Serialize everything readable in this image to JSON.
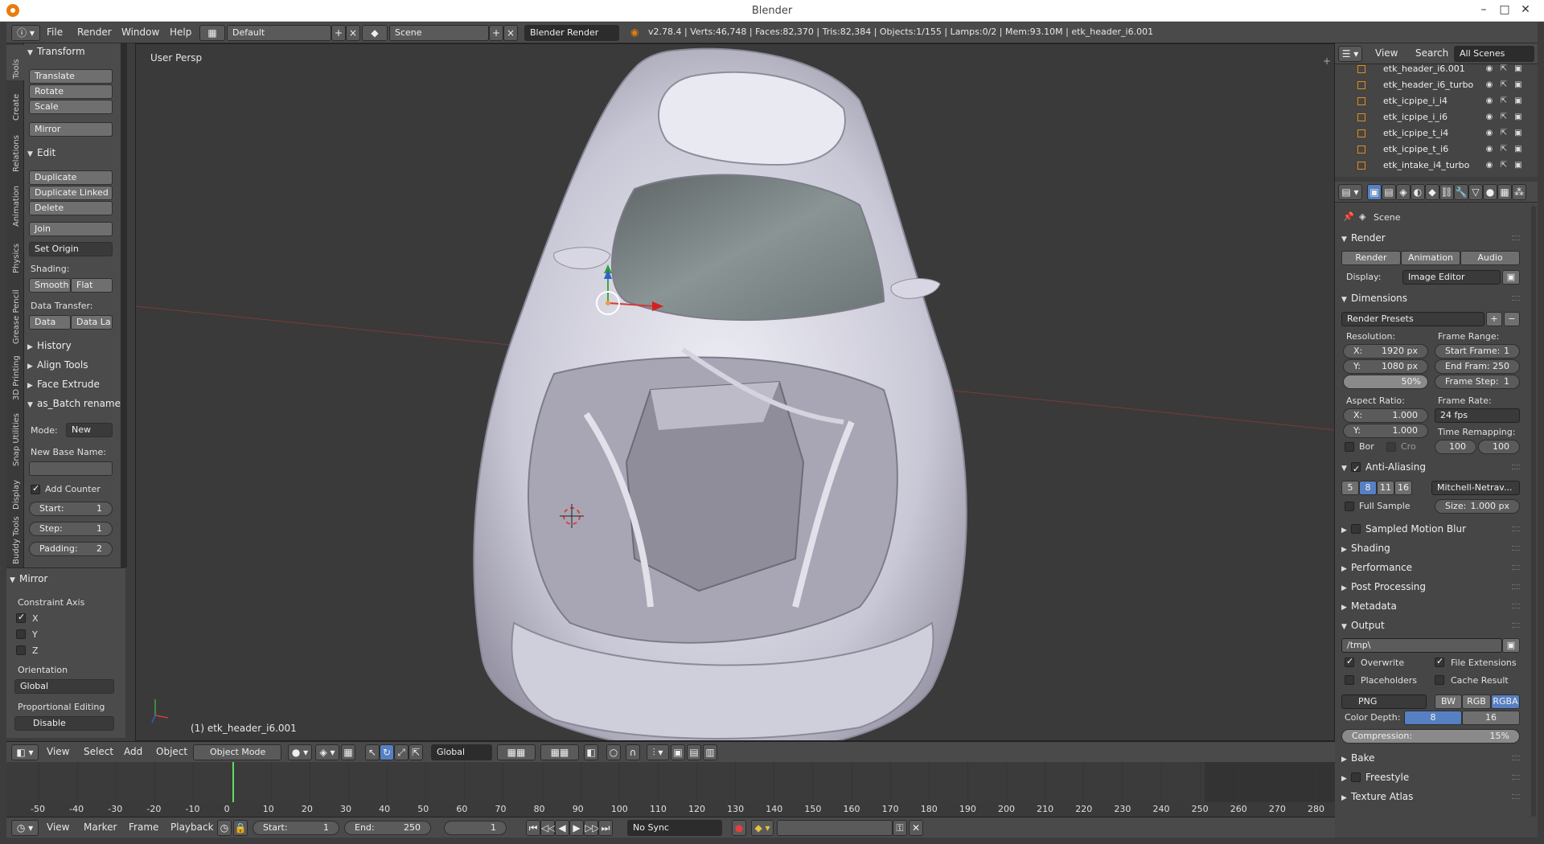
{
  "os": {
    "title": "Blender"
  },
  "menu": {
    "items": [
      "File",
      "Render",
      "Window",
      "Help"
    ],
    "screen_layout": "Default",
    "scene": "Scene",
    "engine": "Blender Render",
    "stats": "v2.78.4 | Verts:46,748 | Faces:82,370 | Tris:82,384 | Objects:1/155 | Lamps:0/2 | Mem:93.10M | etk_header_i6.001"
  },
  "tabs": [
    "Tools",
    "Create",
    "Relations",
    "Animation",
    "Physics",
    "Grease Pencil",
    "3D Printing",
    "Snap Utilities",
    "Display",
    "Buddy Tools"
  ],
  "tools": {
    "transform": {
      "title": "Transform",
      "buttons": [
        "Translate",
        "Rotate",
        "Scale"
      ],
      "mirror": "Mirror"
    },
    "edit": {
      "title": "Edit",
      "buttons": [
        "Duplicate",
        "Duplicate Linked",
        "Delete"
      ],
      "join": "Join",
      "set_origin": "Set Origin",
      "shading_label": "Shading:",
      "smooth": "Smooth",
      "flat": "Flat",
      "data_transfer_label": "Data Transfer:",
      "data": "Data",
      "data_la": "Data La"
    },
    "collapsed": [
      "History",
      "Align Tools",
      "Face Extrude"
    ],
    "batch": {
      "title": "as_Batch rename",
      "mode_label": "Mode:",
      "mode_value": "New",
      "base_name_label": "New Base Name:",
      "base_name_value": "",
      "add_counter": "Add Counter",
      "start_label": "Start:",
      "start_value": "1",
      "step_label": "Step:",
      "step_value": "1",
      "padding_label": "Padding:",
      "padding_value": "2"
    }
  },
  "redo": {
    "title": "Mirror",
    "constraint_label": "Constraint Axis",
    "axes": [
      {
        "label": "X",
        "checked": true
      },
      {
        "label": "Y",
        "checked": false
      },
      {
        "label": "Z",
        "checked": false
      }
    ],
    "orientation_label": "Orientation",
    "orientation_value": "Global",
    "prop_edit_label": "Proportional Editing",
    "prop_edit_value": "Disable"
  },
  "viewport": {
    "view_label": "User Persp",
    "object_label": "(1) etk_header_i6.001"
  },
  "vp_footer": {
    "menus": [
      "View",
      "Select",
      "Add",
      "Object"
    ],
    "mode": "Object Mode",
    "orientation": "Global"
  },
  "timeline": {
    "ticks": [
      "-50",
      "-40",
      "-30",
      "-20",
      "-10",
      "0",
      "10",
      "20",
      "30",
      "40",
      "50",
      "60",
      "70",
      "80",
      "90",
      "100",
      "110",
      "120",
      "130",
      "140",
      "150",
      "160",
      "170",
      "180",
      "190",
      "200",
      "210",
      "220",
      "230",
      "240",
      "250",
      "260",
      "270",
      "280"
    ],
    "current_frame": 0,
    "menus": [
      "View",
      "Marker",
      "Frame",
      "Playback"
    ],
    "start_label": "Start:",
    "start_value": "1",
    "end_label": "End:",
    "end_value": "250",
    "frame_value": "1",
    "sync": "No Sync"
  },
  "outliner": {
    "menus": [
      "View",
      "Search"
    ],
    "filter": "All Scenes",
    "rows": [
      "etk_header_i6.001",
      "etk_header_i6_turbo",
      "etk_icpipe_i_i4",
      "etk_icpipe_i_i6",
      "etk_icpipe_t_i4",
      "etk_icpipe_t_i6",
      "etk_intake_i4_turbo"
    ]
  },
  "properties": {
    "context": "Scene",
    "render": {
      "title": "Render",
      "render_btn": "Render",
      "anim_btn": "Animation",
      "audio_btn": "Audio",
      "display_label": "Display:",
      "display_value": "Image Editor"
    },
    "dimensions": {
      "title": "Dimensions",
      "presets": "Render Presets",
      "res_label": "Resolution:",
      "x_label": "X:",
      "x_value": "1920 px",
      "y_label": "Y:",
      "y_value": "1080 px",
      "pct": "50%",
      "aspect_label": "Aspect Ratio:",
      "ax_label": "X:",
      "ax_value": "1.000",
      "ay_label": "Y:",
      "ay_value": "1.000",
      "bor": "Bor",
      "cro": "Cro",
      "range_label": "Frame Range:",
      "start_label": "Start Frame:",
      "start_value": "1",
      "end_label": "End Fram:",
      "end_value": "250",
      "step_label": "Frame Step:",
      "step_value": "1",
      "rate_label": "Frame Rate:",
      "rate_value": "24 fps",
      "remap_label": "Time Remapping:",
      "remap_old": "100",
      "remap_new": "100"
    },
    "aa": {
      "title": "Anti-Aliasing",
      "samples": [
        "5",
        "8",
        "11",
        "16"
      ],
      "filter": "Mitchell-Netrav...",
      "full_sample": "Full Sample",
      "size_label": "Size:",
      "size_value": "1.000 px"
    },
    "collapsed": [
      "Sampled Motion Blur",
      "Shading",
      "Performance",
      "Post Processing",
      "Metadata"
    ],
    "output": {
      "title": "Output",
      "path": "/tmp\\",
      "overwrite": "Overwrite",
      "file_ext": "File Extensions",
      "placeholders": "Placeholders",
      "cache": "Cache Result",
      "format": "PNG",
      "bw": "BW",
      "rgb": "RGB",
      "rgba": "RGBA",
      "depth_label": "Color Depth:",
      "depth_8": "8",
      "depth_16": "16",
      "compression_label": "Compression:",
      "compression_value": "15%"
    },
    "bottom": [
      "Bake",
      "Freestyle",
      "Texture Atlas"
    ]
  }
}
